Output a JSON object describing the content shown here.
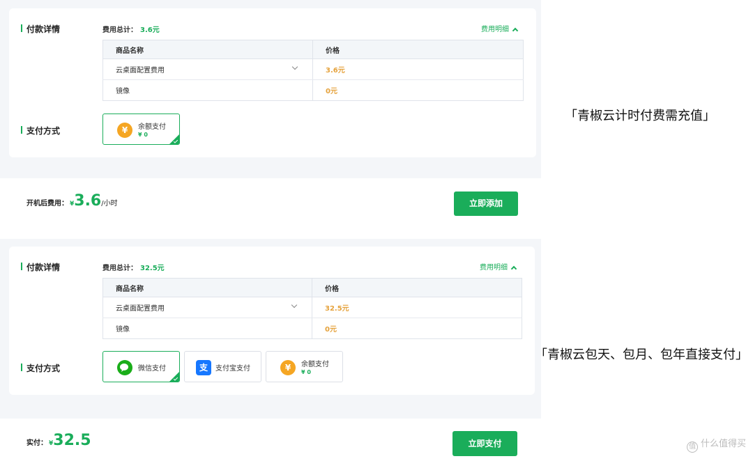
{
  "panel1": {
    "section_payment_detail": "付款详情",
    "total_label": "费用总计：",
    "total_amount": "3.6元",
    "detail_link": "费用明细",
    "table": {
      "headers": [
        "商品名称",
        "价格"
      ],
      "rows": [
        {
          "name": "云桌面配置费用",
          "price": "3.6元",
          "dropdown": true
        },
        {
          "name": "镜像",
          "price": "0元",
          "dropdown": false
        }
      ]
    },
    "section_payment_method": "支付方式",
    "methods": [
      {
        "label": "余额支付",
        "sub": "¥ 0",
        "icon": "yen-icon",
        "selected": true
      }
    ],
    "footer": {
      "label": "开机后费用：",
      "currency": "¥",
      "amount": "3.6",
      "unit": "/小时",
      "button": "立即添加"
    }
  },
  "panel2": {
    "section_payment_detail": "付款详情",
    "total_label": "费用总计：",
    "total_amount": "32.5元",
    "detail_link": "费用明细",
    "table": {
      "headers": [
        "商品名称",
        "价格"
      ],
      "rows": [
        {
          "name": "云桌面配置费用",
          "price": "32.5元",
          "dropdown": true
        },
        {
          "name": "镜像",
          "price": "0元",
          "dropdown": false
        }
      ]
    },
    "section_payment_method": "支付方式",
    "methods": [
      {
        "label": "微信支付",
        "icon": "wechat-icon",
        "selected": true
      },
      {
        "label": "支付宝支付",
        "icon": "alipay-icon",
        "selected": false
      },
      {
        "label": "余额支付",
        "sub": "¥ 0",
        "icon": "yen-icon",
        "selected": false
      }
    ],
    "footer": {
      "label": "实付：",
      "currency": "¥",
      "amount": "32.5",
      "button": "立即支付"
    }
  },
  "captions": {
    "top": "「青椒云计时付费需充值」",
    "bottom": "「青椒云包天、包月、包年直接支付」"
  },
  "watermark": "什么值得买",
  "colors": {
    "accent": "#1aad5a",
    "price": "#e5a23c",
    "balance_icon": "#f5a623",
    "alipay": "#1677ff"
  }
}
